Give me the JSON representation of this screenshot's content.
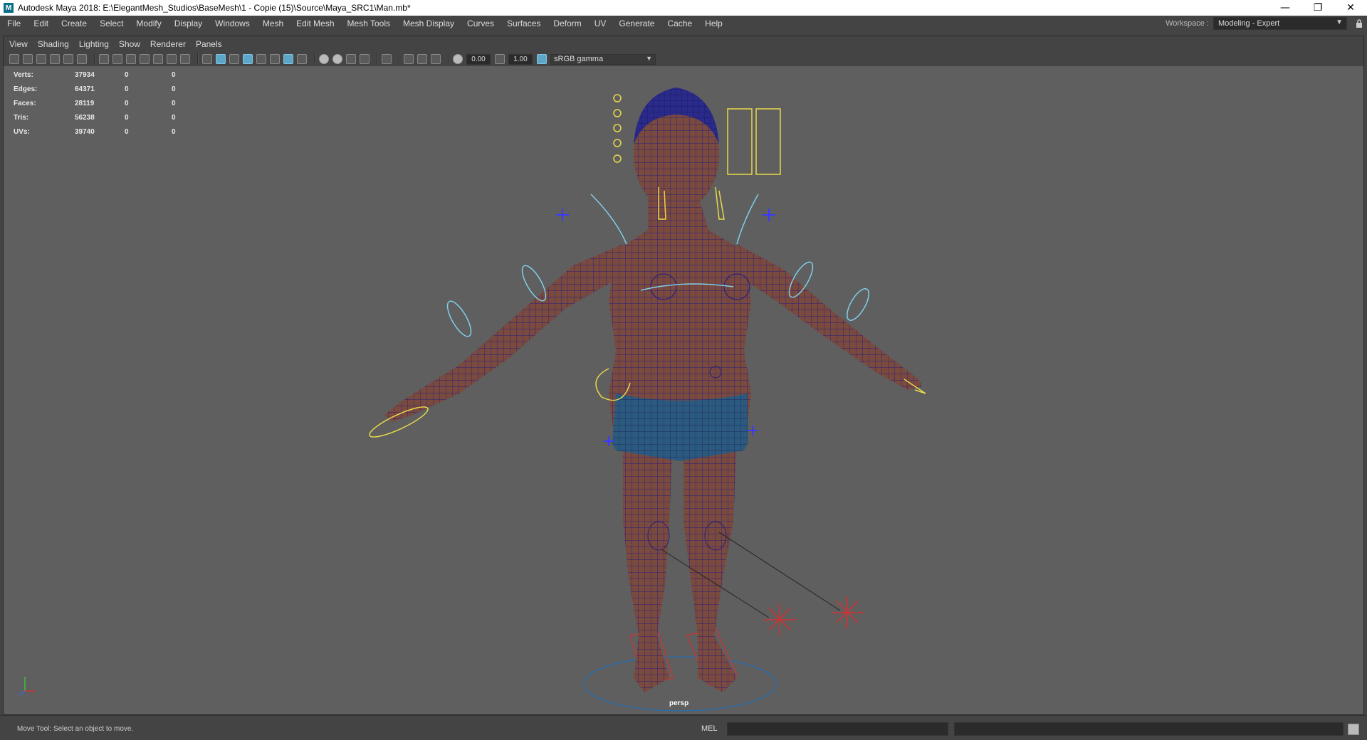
{
  "window": {
    "title": "Autodesk Maya 2018: E:\\ElegantMesh_Studios\\BaseMesh\\1 - Copie (15)\\Source\\Maya_SRC1\\Man.mb*",
    "app_icon": "M",
    "minimize": "—",
    "maximize": "❐",
    "close": "✕"
  },
  "menubar": {
    "items": [
      "File",
      "Edit",
      "Create",
      "Select",
      "Modify",
      "Display",
      "Windows",
      "Mesh",
      "Edit Mesh",
      "Mesh Tools",
      "Mesh Display",
      "Curves",
      "Surfaces",
      "Deform",
      "UV",
      "Generate",
      "Cache",
      "Help"
    ]
  },
  "workspace": {
    "label": "Workspace :",
    "value": "Modeling - Expert",
    "lock": "🔒"
  },
  "panel_menu": {
    "items": [
      "View",
      "Shading",
      "Lighting",
      "Show",
      "Renderer",
      "Panels"
    ]
  },
  "panel_toolbar": {
    "field1": "0.00",
    "field2": "1.00",
    "color_space": "sRGB gamma"
  },
  "hud": {
    "rows": [
      {
        "label": "Verts:",
        "v1": "37934",
        "v2": "0",
        "v3": "0"
      },
      {
        "label": "Edges:",
        "v1": "64371",
        "v2": "0",
        "v3": "0"
      },
      {
        "label": "Faces:",
        "v1": "28119",
        "v2": "0",
        "v3": "0"
      },
      {
        "label": "Tris:",
        "v1": "56238",
        "v2": "0",
        "v3": "0"
      },
      {
        "label": "UVs:",
        "v1": "39740",
        "v2": "0",
        "v3": "0"
      }
    ]
  },
  "viewport": {
    "camera": "persp",
    "background": "#5f5f5f"
  },
  "commandline": {
    "status": "Move Tool: Select an object to move.",
    "mel": "MEL"
  },
  "colors": {
    "mesh_fill": "#7a4a3e",
    "wireframe": "#2a1f7a",
    "shorts": "#2b5a7e",
    "control_yellow": "#e8d84a",
    "control_cyan": "#7fd0e8",
    "ik_red": "#d63030",
    "active_blue": "#5ba6c9"
  }
}
